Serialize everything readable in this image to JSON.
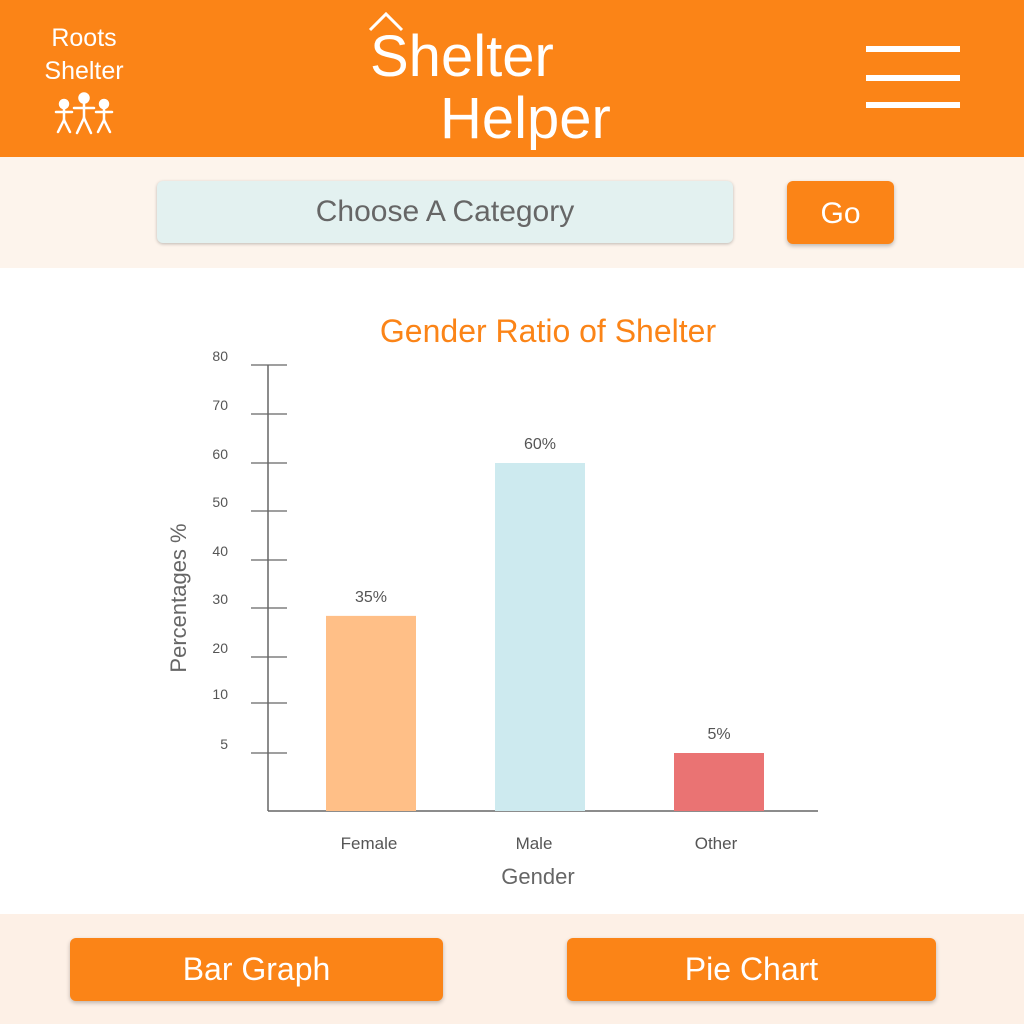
{
  "header": {
    "brand_line1": "Roots",
    "brand_line2": "Shelter",
    "title_line1": "Shelter",
    "title_line2": "Helper",
    "brand_color": "#fb8417"
  },
  "search": {
    "category_label": "Choose A Category",
    "go_label": "Go"
  },
  "footer": {
    "bar_graph_label": "Bar Graph",
    "pie_chart_label": "Pie Chart"
  },
  "chart_data": {
    "type": "bar",
    "title": "Gender Ratio of Shelter",
    "xlabel": "Gender",
    "ylabel": "Percentages  %",
    "categories": [
      "Female",
      "Male",
      "Other"
    ],
    "values": [
      35,
      60,
      5
    ],
    "value_labels": [
      "35%",
      "60%",
      "5%"
    ],
    "colors": [
      "#ffbf87",
      "#cdeaef",
      "#ea7373"
    ],
    "yticks": [
      5,
      10,
      20,
      30,
      40,
      50,
      60,
      70,
      80
    ],
    "ylim": [
      0,
      80
    ],
    "grid": false
  }
}
